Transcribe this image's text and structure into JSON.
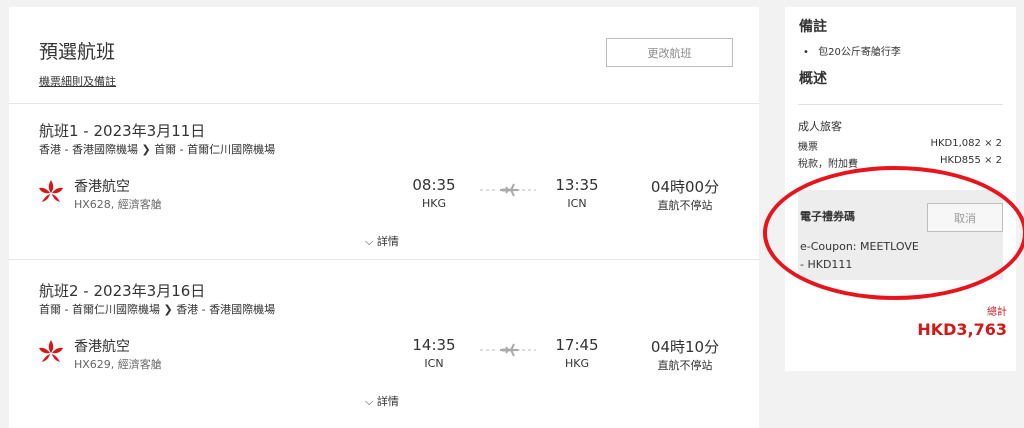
{
  "header": {
    "title": "預選航班",
    "terms_link": "機票細則及備註",
    "change_button": "更改航班"
  },
  "flights": [
    {
      "title": "航班1 - 2023年3月11日",
      "route_from": "香港 - 香港國際機場",
      "route_to": "首爾 - 首爾仁川國際機場",
      "airline": "香港航空",
      "flight_info": "HX628, 經濟客艙",
      "depart_time": "08:35",
      "depart_code": "HKG",
      "arrive_time": "13:35",
      "arrive_code": "ICN",
      "duration": "04時00分",
      "stops": "直航不停站",
      "details_label": "詳情"
    },
    {
      "title": "航班2 - 2023年3月16日",
      "route_from": "首爾 - 首爾仁川國際機場",
      "route_to": "香港 - 香港國際機場",
      "airline": "香港航空",
      "flight_info": "HX629, 經濟客艙",
      "depart_time": "14:35",
      "depart_code": "ICN",
      "arrive_time": "17:45",
      "arrive_code": "HKG",
      "duration": "04時10分",
      "stops": "直航不停站",
      "details_label": "詳情"
    }
  ],
  "sidebar": {
    "remarks_title": "備註",
    "remarks_items": [
      "包20公斤寄艙行李"
    ],
    "overview_title": "概述",
    "passenger_type": "成人旅客",
    "fare_label": "機票",
    "fare_value": "HKD1,082 × 2",
    "tax_label": "稅款，附加費",
    "tax_value": "HKD855 × 2",
    "coupon_title": "電子禮券碼",
    "coupon_cancel": "取消",
    "coupon_line1": "e-Coupon: MEETLOVE",
    "coupon_line2": "- HKD111",
    "total_label": "總計",
    "total_value": "HKD3,763"
  },
  "colors": {
    "brand_red": "#d31818",
    "highlight_ring": "#e8141c"
  },
  "icons": [
    "airline-logo-icon",
    "plane-icon",
    "chevron-down-icon",
    "route-arrow-icon"
  ]
}
